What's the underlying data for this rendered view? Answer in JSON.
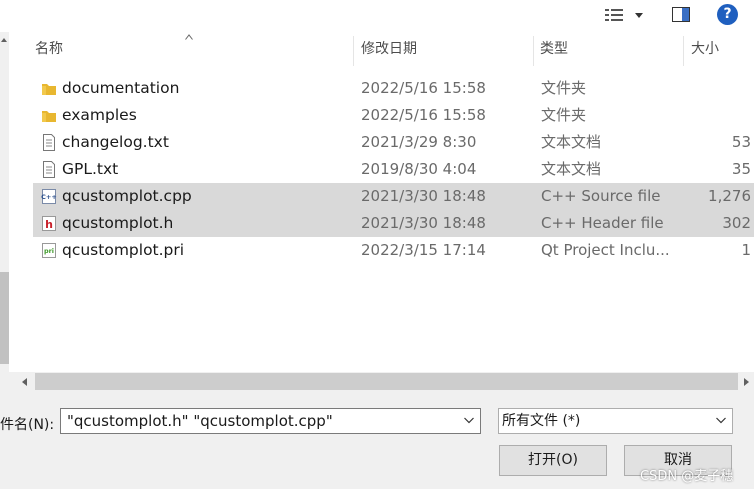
{
  "header": {
    "columns": [
      {
        "label": "名称"
      },
      {
        "label": "修改日期"
      },
      {
        "label": "类型"
      },
      {
        "label": "大小"
      }
    ]
  },
  "toolbar": {
    "help_label": "?",
    "icons": [
      "view-options-icon",
      "preview-pane-icon",
      "help-icon"
    ]
  },
  "files": [
    {
      "name": "documentation",
      "date": "2022/5/16 15:58",
      "type": "文件夹",
      "size": "",
      "icon": "folder-icon",
      "selected": false
    },
    {
      "name": "examples",
      "date": "2022/5/16 15:58",
      "type": "文件夹",
      "size": "",
      "icon": "folder-icon",
      "selected": false
    },
    {
      "name": "changelog.txt",
      "date": "2021/3/29 8:30",
      "type": "文本文档",
      "size": "53",
      "icon": "text-file-icon",
      "selected": false
    },
    {
      "name": "GPL.txt",
      "date": "2019/8/30 4:04",
      "type": "文本文档",
      "size": "35",
      "icon": "text-file-icon",
      "selected": false
    },
    {
      "name": "qcustomplot.cpp",
      "date": "2021/3/30 18:48",
      "type": "C++ Source file",
      "size": "1,276",
      "icon": "cpp-file-icon",
      "selected": true
    },
    {
      "name": "qcustomplot.h",
      "date": "2021/3/30 18:48",
      "type": "C++ Header file",
      "size": "302",
      "icon": "header-file-icon",
      "selected": true
    },
    {
      "name": "qcustomplot.pri",
      "date": "2022/3/15 17:14",
      "type": "Qt Project Inclu...",
      "size": "1",
      "icon": "pri-file-icon",
      "selected": false
    }
  ],
  "filename": {
    "label": "件名(N):",
    "value": "\"qcustomplot.h\" \"qcustomplot.cpp\""
  },
  "filetype": {
    "value": "所有文件 (*)"
  },
  "buttons": {
    "open": "打开(O)",
    "cancel": "取消"
  },
  "watermark": "CSDN @麦子穗",
  "colors": {
    "selection": "#d9d9d9",
    "help_blue": "#1f5fbf",
    "folder_yellow": "#e8b730"
  }
}
